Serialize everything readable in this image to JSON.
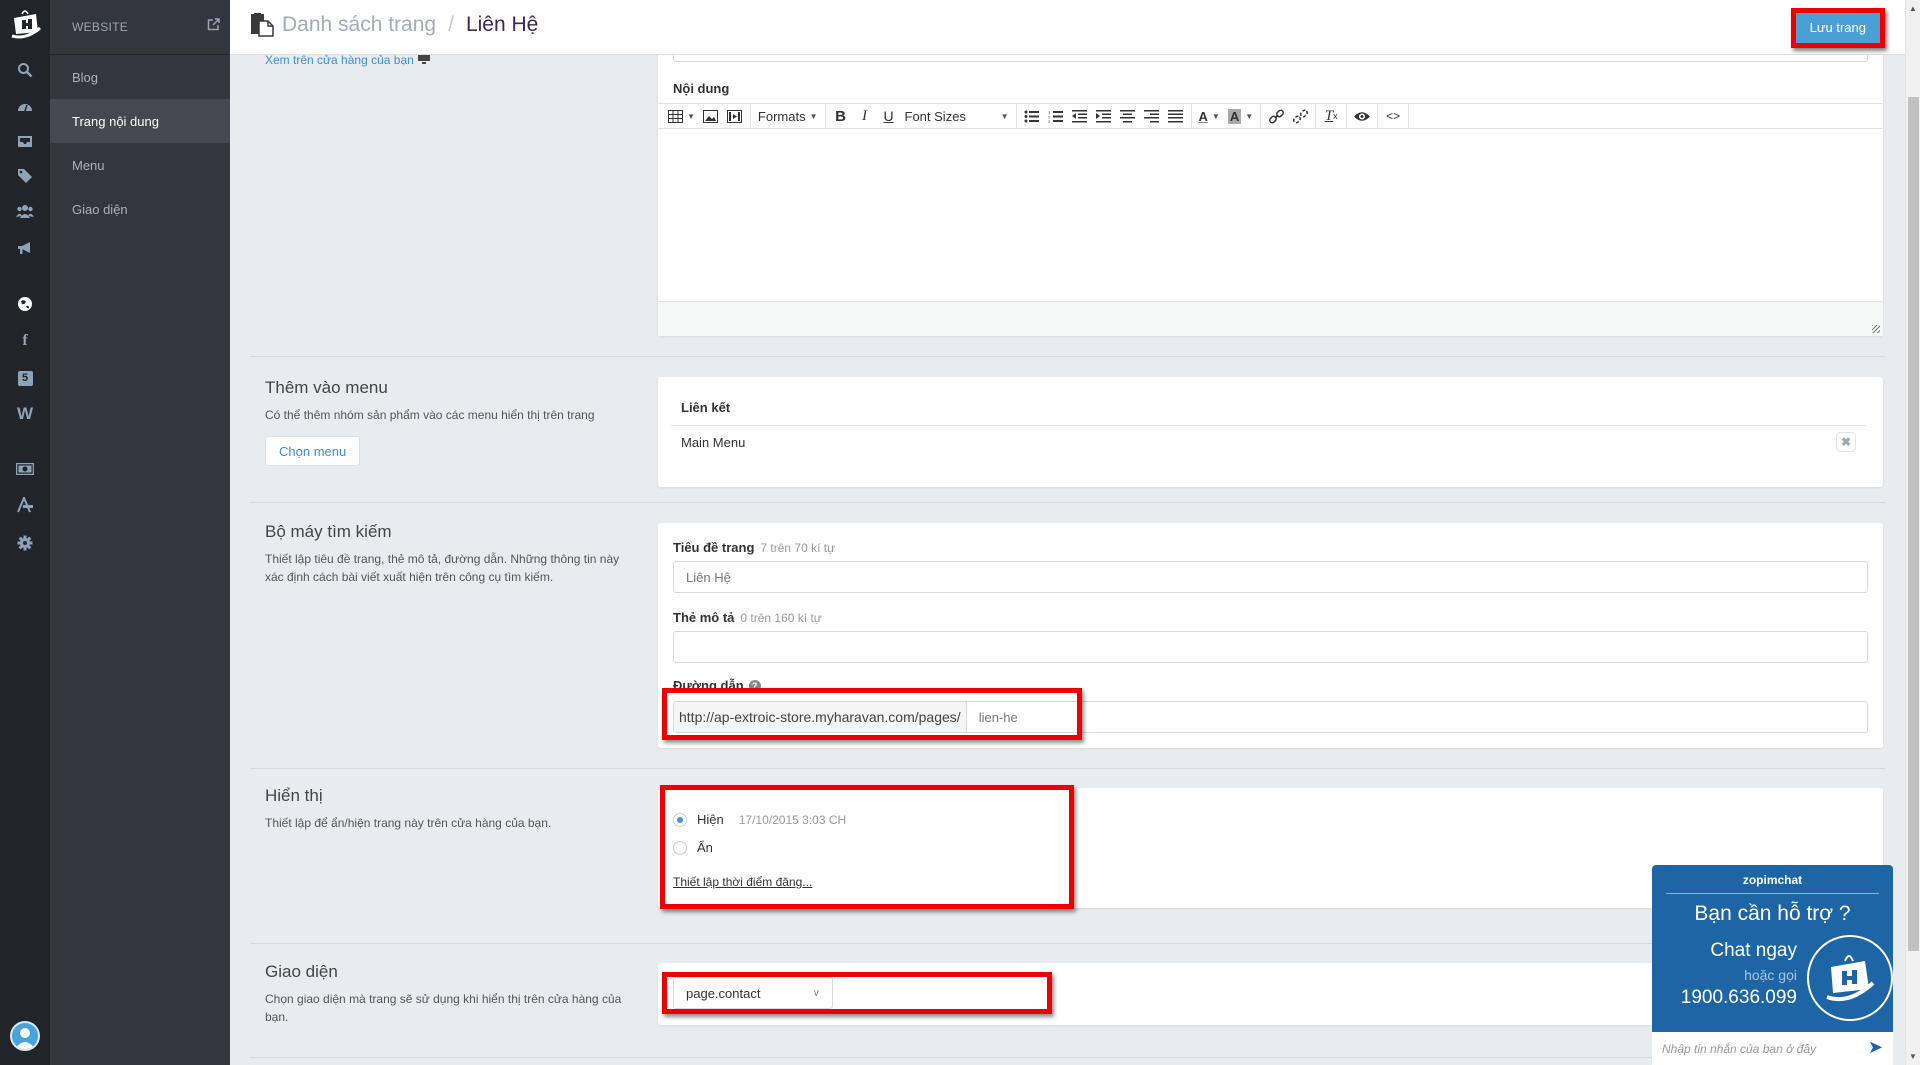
{
  "rail": {
    "icons": [
      "logo-icon",
      "search-icon",
      "dashboard-icon",
      "inbox-icon",
      "tags-icon",
      "users-icon",
      "megaphone-icon",
      "globe-icon",
      "facebook-icon",
      "html5-icon",
      "w-icon",
      "money-icon",
      "app-store-icon",
      "gear-icon",
      "avatar-icon"
    ]
  },
  "subnav": {
    "title": "WEBSITE",
    "items": [
      {
        "label": "Blog",
        "active": false
      },
      {
        "label": "Trang nội dung",
        "active": true
      },
      {
        "label": "Menu",
        "active": false
      },
      {
        "label": "Giao diện",
        "active": false
      }
    ]
  },
  "header": {
    "breadcrumb_parent": "Danh sách trang",
    "separator": "/",
    "breadcrumb_current": "Liên Hệ",
    "save_label": "Lưu trang"
  },
  "main": {
    "view_link": "Xem trên cửa hàng của bạn",
    "content_label": "Nội dung",
    "toolbar": {
      "formats": "Formats",
      "font_sizes": "Font Sizes",
      "buttons": [
        "table",
        "image",
        "media",
        "formats",
        "bold",
        "italic",
        "underline",
        "font-sizes",
        "bullet-list",
        "numbered-list",
        "outdent",
        "indent",
        "align-center",
        "align-right",
        "justify",
        "text-color",
        "background-color",
        "link",
        "unlink",
        "clear-format",
        "preview",
        "source-code"
      ]
    },
    "menu_section": {
      "title": "Thêm vào menu",
      "desc": "Có thể thêm nhóm sản phẩm vào các menu hiển thị trên trang",
      "button": "Chọn menu",
      "table_header": "Liên kết",
      "rows": [
        "Main Menu"
      ]
    },
    "seo_section": {
      "title": "Bộ máy tìm kiếm",
      "desc": "Thiết lập tiêu đề trang, thẻ mô tả, đường dẫn. Những thông tin này xác định cách bài viết xuất hiện trên công cụ tìm kiếm.",
      "page_title_label": "Tiêu đề trang",
      "page_title_hint": "7 trên 70 kí tự",
      "page_title_placeholder": "Liên Hệ",
      "meta_label": "Thẻ mô tả",
      "meta_hint": "0 trên 160 kí tự",
      "meta_value": "",
      "url_label": "Đường dẫn",
      "url_prefix": "http://ap-extroic-store.myharavan.com/pages/",
      "url_placeholder": "lien-he"
    },
    "visibility_section": {
      "title": "Hiển thị",
      "desc": "Thiết lập để ẩn/hiện trang này trên cửa hàng của bạn.",
      "options": [
        {
          "label": "Hiện",
          "note": "17/10/2015 3:03 CH",
          "selected": true
        },
        {
          "label": "Ẩn",
          "note": "",
          "selected": false
        }
      ],
      "schedule_link": "Thiết lập thời điểm đăng..."
    },
    "template_section": {
      "title": "Giao diện",
      "desc": "Chọn giao diện mà trang sẽ sử dụng khi hiển thị trên cửa hàng của bạn.",
      "selected": "page.contact"
    }
  },
  "chat": {
    "brand": "zopimchat",
    "question": "Bạn cần hỗ trợ ?",
    "chat_now": "Chat ngay",
    "or_call": "hoặc gọi",
    "phone": "1900.636.099",
    "input_placeholder": "Nhập tin nhắn của bạn ở đây"
  },
  "colors": {
    "accent": "#4a9fd4",
    "highlight": "#ee0000",
    "chat_bg": "#1e65a5",
    "rail_bg": "#212429",
    "subnav_bg": "#32363d"
  }
}
